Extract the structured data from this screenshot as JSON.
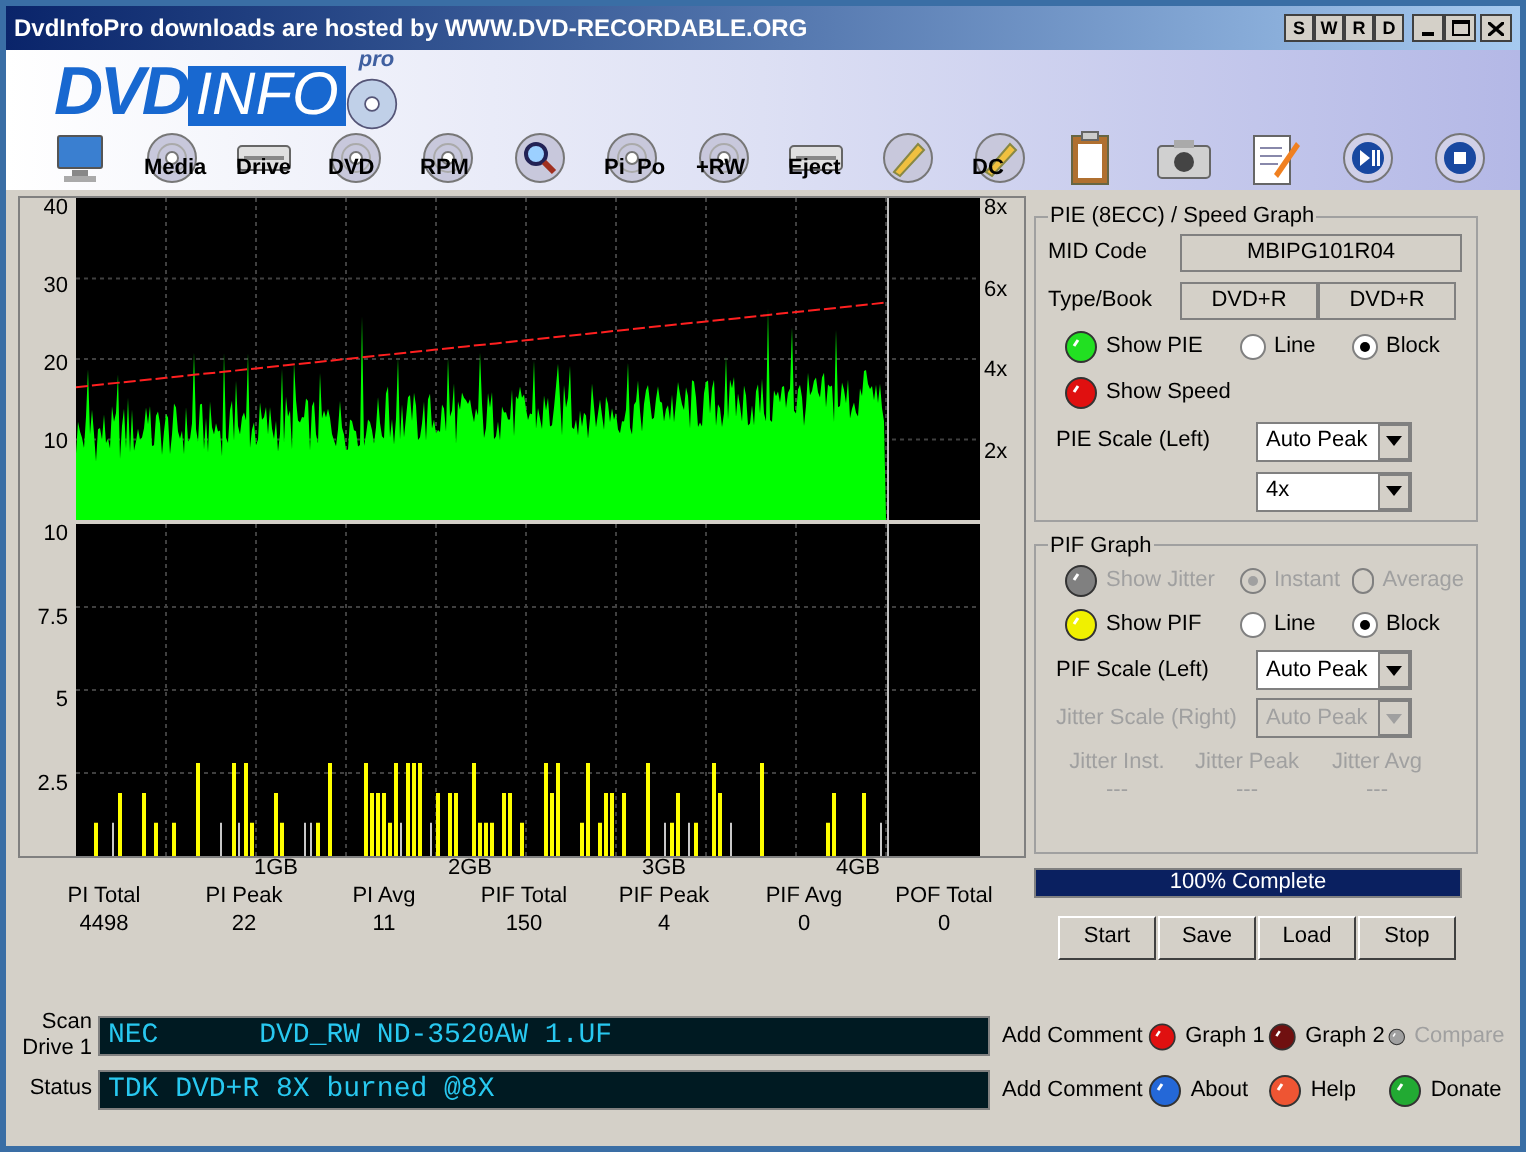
{
  "window": {
    "title": "DvdInfoPro downloads are hosted by WWW.DVD-RECORDABLE.ORG",
    "title_buttons": [
      "S",
      "W",
      "R",
      "D"
    ]
  },
  "logo": {
    "text_1": "DVD",
    "text_2": "INFO",
    "badge": "pro"
  },
  "toolbar": [
    {
      "kind": "monitor"
    },
    {
      "kind": "disc",
      "label": "Media"
    },
    {
      "kind": "drive",
      "label": "Drive"
    },
    {
      "kind": "disc",
      "label": "DVD"
    },
    {
      "kind": "disc",
      "label": "RPM"
    },
    {
      "kind": "search"
    },
    {
      "kind": "disc",
      "label": "Pi  Po"
    },
    {
      "kind": "disc",
      "label": "+RW"
    },
    {
      "kind": "drive",
      "label": "Eject"
    },
    {
      "kind": "pen"
    },
    {
      "kind": "pen",
      "label": "DC"
    },
    {
      "kind": "clipboard"
    },
    {
      "kind": "camera"
    },
    {
      "kind": "notepad"
    },
    {
      "kind": "play"
    },
    {
      "kind": "stop"
    }
  ],
  "pie_plot": {
    "y_labels": [
      "40",
      "30",
      "20",
      "10"
    ],
    "speed_labels": [
      "8x",
      "6x",
      "4x",
      "2x"
    ]
  },
  "pif_plot": {
    "y_labels": [
      "10",
      "7.5",
      "5",
      "2.5"
    ]
  },
  "x_labels": [
    "1GB",
    "2GB",
    "3GB",
    "4GB"
  ],
  "stats": [
    {
      "label": "PI Total",
      "value": "4498"
    },
    {
      "label": "PI Peak",
      "value": "22"
    },
    {
      "label": "PI Avg",
      "value": "11"
    },
    {
      "label": "PIF Total",
      "value": "150"
    },
    {
      "label": "PIF Peak",
      "value": "4"
    },
    {
      "label": "PIF Avg",
      "value": "0"
    },
    {
      "label": "POF Total",
      "value": "0"
    }
  ],
  "pie_panel": {
    "title": "PIE (8ECC) / Speed Graph",
    "mid_label": "MID Code",
    "mid_value": "MBIPG101R04",
    "type_label": "Type/Book",
    "type_value": "DVD+R",
    "book_value": "DVD+R",
    "rows": [
      {
        "led": {
          "label": "Show PIE",
          "color": "#22e022",
          "disabled": false
        },
        "radios": [
          {
            "label": "Line",
            "selected": false,
            "disabled": false
          },
          {
            "label": "Block",
            "selected": true,
            "disabled": false
          }
        ]
      },
      {
        "led": {
          "label": "Show Speed",
          "color": "#e01010",
          "disabled": false
        },
        "radios": []
      }
    ],
    "scales": [
      {
        "label": "PIE Scale (Left)",
        "value": "Auto Peak",
        "disabled": false
      },
      {
        "value": "4x",
        "disabled": false
      }
    ]
  },
  "pif_panel": {
    "title": "PIF Graph",
    "rows": [
      {
        "led": {
          "label": "Show Jitter",
          "color": "#808080",
          "disabled": true
        },
        "radios": [
          {
            "label": "Instant",
            "selected": true,
            "disabled": true
          },
          {
            "label": "Average",
            "selected": false,
            "disabled": true
          }
        ]
      },
      {
        "led": {
          "label": "Show PIF",
          "color": "#f0f000",
          "disabled": false
        },
        "radios": [
          {
            "label": "Line",
            "selected": false,
            "disabled": false
          },
          {
            "label": "Block",
            "selected": true,
            "disabled": false
          }
        ]
      }
    ],
    "scales": [
      {
        "label": "PIF Scale (Left)",
        "value": "Auto Peak",
        "disabled": false
      },
      {
        "label": "Jitter Scale (Right)",
        "value": "Auto Peak",
        "disabled": true
      }
    ],
    "jitter_stats": [
      {
        "label": "Jitter Inst.",
        "value": "---",
        "disabled": true
      },
      {
        "label": "Jitter Peak",
        "value": "---",
        "disabled": true
      },
      {
        "label": "Jitter Avg",
        "value": "---",
        "disabled": true
      }
    ]
  },
  "progress": {
    "label": "100% Complete",
    "level": 1
  },
  "buttons": [
    "Start",
    "Save",
    "Load",
    "Stop"
  ],
  "bottom_rows": [
    {
      "label_lines": [
        "Scan",
        "Drive 1"
      ],
      "display": "NEC      DVD_RW ND-3520AW 1.UF",
      "comment": "Add Comment",
      "links": [
        {
          "label": "Graph 1",
          "color": "#e01010",
          "disabled": false
        },
        {
          "label": "Graph 2",
          "color": "#701010",
          "disabled": false
        },
        {
          "label": "Compare",
          "color": "#a0a0a0",
          "disabled": true
        }
      ]
    },
    {
      "label_lines": [
        "Status"
      ],
      "display": "TDK DVD+R 8X burned @8X",
      "comment": "Add Comment",
      "links": [
        {
          "label": "About",
          "color": "#2468d8",
          "disabled": false
        },
        {
          "label": "Help",
          "color": "#ee5533",
          "disabled": false
        },
        {
          "label": "Donate",
          "color": "#22aa33",
          "disabled": false
        }
      ]
    }
  ]
}
